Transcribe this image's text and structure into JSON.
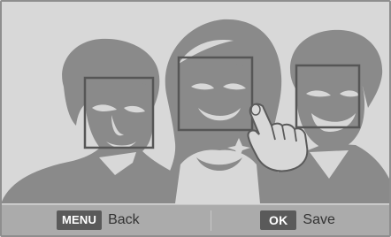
{
  "screen": {
    "background": "#d8d8d8",
    "silhouette_color": "#8a8a8a",
    "face_box_color": "#565656"
  },
  "face_boxes": [
    {
      "name": "left-person"
    },
    {
      "name": "center-person"
    },
    {
      "name": "right-person"
    }
  ],
  "touch_hint": {
    "icon": "hand-pointer-icon"
  },
  "bottom_bar": {
    "back": {
      "key": "MENU",
      "label": "Back"
    },
    "save": {
      "key": "OK",
      "label": "Save"
    }
  }
}
